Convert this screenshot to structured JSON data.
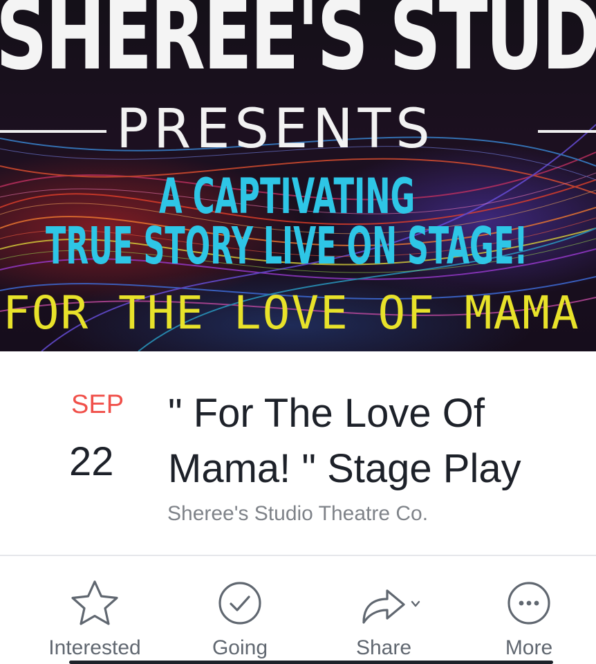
{
  "banner": {
    "title": "SHEREE'S STUDIO",
    "presents": "PRESENTS",
    "tagline_1": "A CAPTIVATING",
    "tagline_2": "TRUE STORY LIVE ON STAGE!",
    "tagline_3": "FOR THE LOVE OF MAMA",
    "colors": {
      "title": "#f4f4f4",
      "tagline": "#2ec6e6",
      "show": "#e8e22a"
    }
  },
  "event": {
    "month": "SEP",
    "day": "22",
    "title": "\" For The Love Of Mama! \" Stage Play",
    "host": "Sheree's Studio Theatre Co.",
    "colors": {
      "month": "#f0504a",
      "text": "#1d2129",
      "host": "#7f8389"
    }
  },
  "actions": [
    {
      "label": "Interested",
      "icon": "star-icon"
    },
    {
      "label": "Going",
      "icon": "check-circle-icon"
    },
    {
      "label": "Share",
      "icon": "share-arrow-icon"
    },
    {
      "label": "More",
      "icon": "more-dots-icon"
    }
  ]
}
